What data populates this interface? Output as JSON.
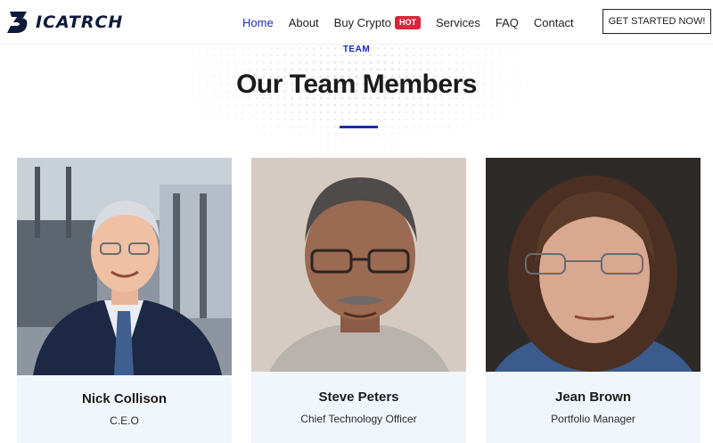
{
  "header": {
    "logo_text": "ICATRCH",
    "nav": [
      {
        "label": "Home",
        "active": true
      },
      {
        "label": "About"
      },
      {
        "label": "Buy Crypto",
        "badge": "HOT"
      },
      {
        "label": "Services"
      },
      {
        "label": "FAQ"
      },
      {
        "label": "Contact"
      }
    ],
    "cta_label": "GET STARTED NOW!"
  },
  "section": {
    "eyebrow": "TEAM",
    "title": "Our Team Members"
  },
  "team": [
    {
      "name": "Nick Collison",
      "role": "C.E.O"
    },
    {
      "name": "Steve Peters",
      "role": "Chief Technology Officer"
    },
    {
      "name": "Jean Brown",
      "role": "Portfolio Manager"
    }
  ],
  "colors": {
    "accent": "#1b2ab8",
    "hot_badge": "#d7263d",
    "card_bg": "#f1f6fd"
  }
}
